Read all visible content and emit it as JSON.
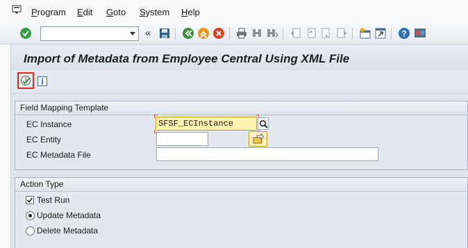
{
  "menu": {
    "items": [
      "Program",
      "Edit",
      "Goto",
      "System",
      "Help"
    ]
  },
  "toolbar": {
    "command_field": {
      "value": "",
      "placeholder": ""
    },
    "icons": [
      "enter-icon",
      "save-icon",
      "back-icon",
      "exit-icon",
      "cancel-icon",
      "print-icon",
      "find-icon",
      "find-next-icon",
      "first-page-icon",
      "previous-page-icon",
      "next-page-icon",
      "last-page-icon",
      "create-session-icon",
      "shortcut-icon",
      "help-icon",
      "customize-layout-icon"
    ]
  },
  "page": {
    "title": "Import of Metadata from Employee Central Using XML File"
  },
  "app_toolbar": {
    "icons": [
      "execute-icon",
      "info-icon"
    ]
  },
  "field_mapping": {
    "heading": "Field Mapping Template",
    "ec_instance_label": "EC Instance",
    "ec_instance_value": "SFSF_ECInstance",
    "ec_entity_label": "EC Entity",
    "ec_entity_value": "",
    "ec_metadata_file_label": "EC Metadata File",
    "ec_metadata_file_value": ""
  },
  "action_type": {
    "heading": "Action Type",
    "test_run_label": "Test Run",
    "test_run_checked": true,
    "update_label": "Update Metadata",
    "delete_label": "Delete Metadata",
    "selected": "Update Metadata"
  },
  "colors": {
    "accent_red": "#e2261c",
    "active_field_bg": "#fef2b0",
    "enter_green": "#2ea043"
  }
}
